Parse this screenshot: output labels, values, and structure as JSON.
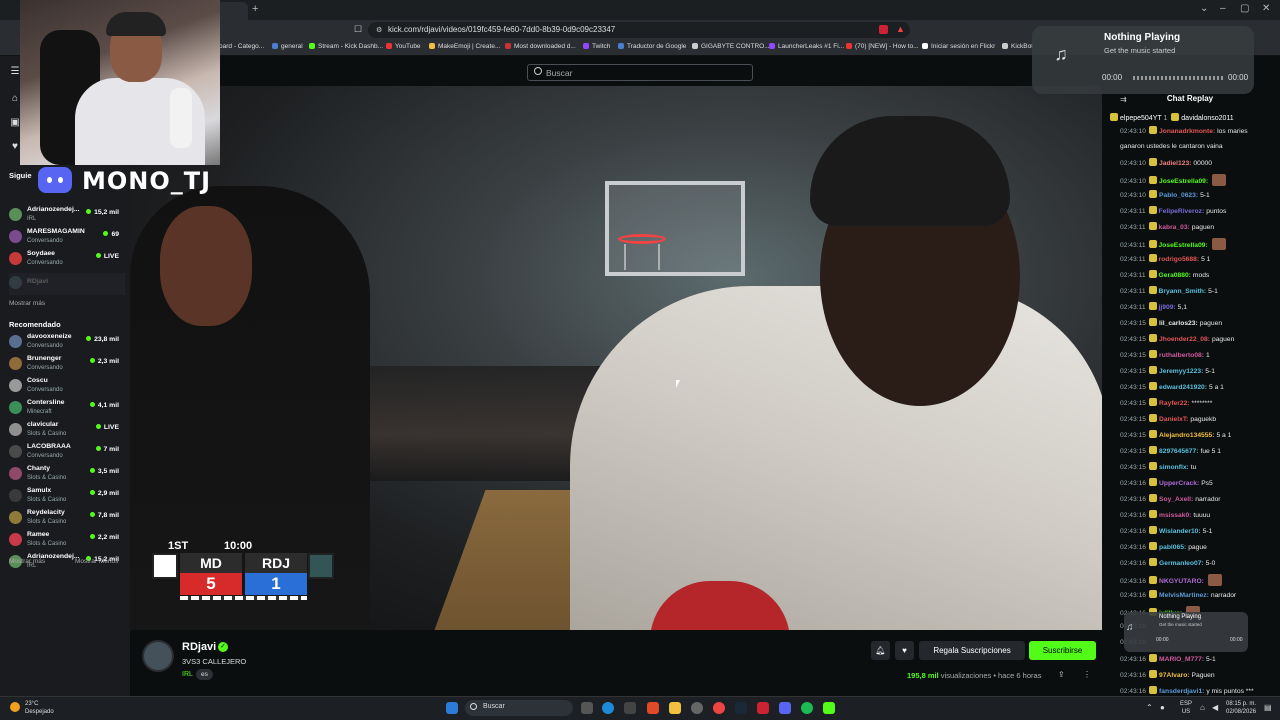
{
  "browser": {
    "tab_title": "",
    "url": "kick.com/rdjavi/videos/019fc459-fe60-7dd0-8b39-0d9c09c23347",
    "bookmarks": [
      "oard - Catego...",
      "general",
      "Stream - Kick Dashb...",
      "YouTube",
      "MakeEmoji | Create...",
      "Most downloaded d...",
      "Twitch",
      "Traductor de Google",
      "GIGABYTE CONTRO...",
      "LauncherLeaks #1 Fi...",
      "(70) [NEW] - How to...",
      "Iniciar sesión en Flickr",
      "KickBot"
    ]
  },
  "search": {
    "placeholder": "Buscar"
  },
  "overlay": {
    "streamer_tag": "MONO_TJ"
  },
  "sidebar": {
    "following_heading": "Siguie",
    "following": [
      {
        "name": "Adrianozendej...",
        "category": "IRL",
        "viewers": "15,2 mil",
        "color": "#5a8f5a"
      },
      {
        "name": "MARESMAGAMIN",
        "category": "Conversando",
        "viewers": "69",
        "color": "#7a4b8f"
      },
      {
        "name": "Soydaee",
        "category": "Conversando",
        "viewers": "LIVE",
        "color": "#c83a3a"
      },
      {
        "name": "RDjavi",
        "category": "",
        "viewers": "",
        "color": "#44505a"
      }
    ],
    "show_more": "Mostrar más",
    "recommended_heading": "Recomendado",
    "recommended": [
      {
        "name": "davooxeneize",
        "category": "Conversando",
        "viewers": "23,8 mil",
        "color": "#5a6f8f"
      },
      {
        "name": "Brunenger",
        "category": "Conversando",
        "viewers": "2,3 mil",
        "color": "#8f6a3a"
      },
      {
        "name": "Coscu",
        "category": "Conversando",
        "viewers": "",
        "color": "#999999"
      },
      {
        "name": "Contersline",
        "category": "Minecraft",
        "viewers": "4,1 mil",
        "color": "#3a8f5a"
      },
      {
        "name": "clavicular",
        "category": "Slots & Casino",
        "viewers": "LIVE",
        "color": "#8f8f8f"
      },
      {
        "name": "LACOBRAAA",
        "category": "Conversando",
        "viewers": "7 mil",
        "color": "#4a4a4a"
      },
      {
        "name": "Chanty",
        "category": "Slots & Casino",
        "viewers": "3,5 mil",
        "color": "#8f4a6a"
      },
      {
        "name": "Samulx",
        "category": "Slots & Casino",
        "viewers": "2,9 mil",
        "color": "#3a3a3a"
      },
      {
        "name": "Reydelacity",
        "category": "Slots & Casino",
        "viewers": "7,8 mil",
        "color": "#8f7a3a"
      },
      {
        "name": "Ramee",
        "category": "Slots & Casino",
        "viewers": "2,2 mil",
        "color": "#c83a4a"
      },
      {
        "name": "Adrianozendej...",
        "category": "IRL",
        "viewers": "15,2 mil",
        "color": "#5a8f5a"
      }
    ],
    "show_more_2": "Mostrar más",
    "show_less": "Mostrar Menos"
  },
  "scorebug": {
    "period": "1ST",
    "clock": "10:00",
    "team1": "MD",
    "score1": "5",
    "team2": "RDJ",
    "score2": "1"
  },
  "stream": {
    "channel": "RDjavi",
    "title": "3VS3 CALLEJERO",
    "category": "IRL",
    "tag": "es",
    "gift_label": "Regala Suscripciones",
    "subscribe_label": "Suscribirse",
    "views": "195,8 mil",
    "views_label": "visualizaciones",
    "ago": "hace 6 horas"
  },
  "chat": {
    "header": "Chat Replay",
    "pinned": [
      "elpepe504YT",
      "1",
      "davidalonso2011"
    ],
    "messages": [
      {
        "time": "02:43:10",
        "user": "Jonanadrkmonte:",
        "color": "#e25555",
        "text": "los maries"
      },
      {
        "time": "",
        "user": "",
        "color": "#e8e8e8",
        "text": "ganaron ustedes le cantaron vaina"
      },
      {
        "time": "02:43:10",
        "user": "Jadiel123:",
        "color": "#f08080",
        "text": "00000"
      },
      {
        "time": "02:43:10",
        "user": "JoseEstrella09:",
        "color": "#53fc18",
        "text": ""
      },
      {
        "time": "02:43:10",
        "user": "Pablo_0623:",
        "color": "#5b9bd5",
        "text": "5-1"
      },
      {
        "time": "02:43:11",
        "user": "FelipeRiveroz:",
        "color": "#7a6ad8",
        "text": "puntos"
      },
      {
        "time": "02:43:11",
        "user": "kabra_03:",
        "color": "#d05aa0",
        "text": "paguen"
      },
      {
        "time": "02:43:11",
        "user": "JoseEstrella09:",
        "color": "#53fc18",
        "text": ""
      },
      {
        "time": "02:43:11",
        "user": "rodrigo5688:",
        "color": "#e25555",
        "text": "5 1"
      },
      {
        "time": "02:43:11",
        "user": "Gera0880:",
        "color": "#53fc18",
        "text": "mods"
      },
      {
        "time": "02:43:11",
        "user": "Bryann_Smith:",
        "color": "#5bc0de",
        "text": "5-1"
      },
      {
        "time": "02:43:11",
        "user": "jj909:",
        "color": "#7a6ad8",
        "text": "5,1"
      },
      {
        "time": "02:43:15",
        "user": "lil_carlos23:",
        "color": "#e8e8e8",
        "text": "paguen"
      },
      {
        "time": "02:43:15",
        "user": "Jhoender22_08:",
        "color": "#e25555",
        "text": "paguen"
      },
      {
        "time": "02:43:15",
        "user": "ruthalberto08:",
        "color": "#d05aa0",
        "text": "1"
      },
      {
        "time": "02:43:15",
        "user": "Jeremyy1223:",
        "color": "#5bc0de",
        "text": "5-1"
      },
      {
        "time": "02:43:15",
        "user": "edward241920:",
        "color": "#5bc0de",
        "text": "5 a 1"
      },
      {
        "time": "02:43:15",
        "user": "Rayfer22:",
        "color": "#e25555",
        "text": "********"
      },
      {
        "time": "02:43:15",
        "user": "DanielxT:",
        "color": "#e25555",
        "text": "paguekb"
      },
      {
        "time": "02:43:15",
        "user": "Alejandro134555:",
        "color": "#f0c040",
        "text": "5 a 1"
      },
      {
        "time": "02:43:15",
        "user": "8297645677:",
        "color": "#5bc0de",
        "text": "fue 5 1"
      },
      {
        "time": "02:43:15",
        "user": "simonflx:",
        "color": "#5bc0de",
        "text": "tu"
      },
      {
        "time": "02:43:16",
        "user": "UpperCrack:",
        "color": "#b06ad8",
        "text": "Ps5"
      },
      {
        "time": "02:43:16",
        "user": "Soy_Axell:",
        "color": "#d05aa0",
        "text": "narrador"
      },
      {
        "time": "02:43:16",
        "user": "msissak0:",
        "color": "#d05aa0",
        "text": "tuuuu"
      },
      {
        "time": "02:43:16",
        "user": "Wislander10:",
        "color": "#5bc0de",
        "text": "5-1"
      },
      {
        "time": "02:43:16",
        "user": "pabl065:",
        "color": "#5bc0de",
        "text": "pague"
      },
      {
        "time": "02:43:16",
        "user": "Germanleo07:",
        "color": "#5bc0de",
        "text": "5-0"
      },
      {
        "time": "02:43:16",
        "user": "NKGYUTARO:",
        "color": "#b06ad8",
        "text": ""
      },
      {
        "time": "02:43:16",
        "user": "MelvisMartinez:",
        "color": "#5b9bd5",
        "text": "narrador"
      },
      {
        "time": "02:43:16",
        "user": "julilive:",
        "color": "#53fc18",
        "text": ""
      },
      {
        "time": "02:43:16",
        "user": "",
        "color": "#e8e8e8",
        "text": ""
      },
      {
        "time": "02:43:16",
        "user": "",
        "color": "#e8e8e8",
        "text": ""
      },
      {
        "time": "02:43:16",
        "user": "MARIO_M777:",
        "color": "#d05aa0",
        "text": "5-1"
      },
      {
        "time": "02:43:16",
        "user": "97Alvaro:",
        "color": "#f0c040",
        "text": "Paguen"
      },
      {
        "time": "02:43:16",
        "user": "fansderdjavi1:",
        "color": "#5b9bd5",
        "text": "y mis puntos ***"
      }
    ]
  },
  "music": {
    "title": "Nothing Playing",
    "subtitle": "Get the music started",
    "t_start": "00:00",
    "t_end": "00:00"
  },
  "taskbar": {
    "temp": "23°C",
    "weather": "Despejado",
    "search": "Buscar",
    "lang1": "ESP",
    "lang2": "US",
    "time": "08:15 p. m.",
    "date": "02/08/2026"
  }
}
